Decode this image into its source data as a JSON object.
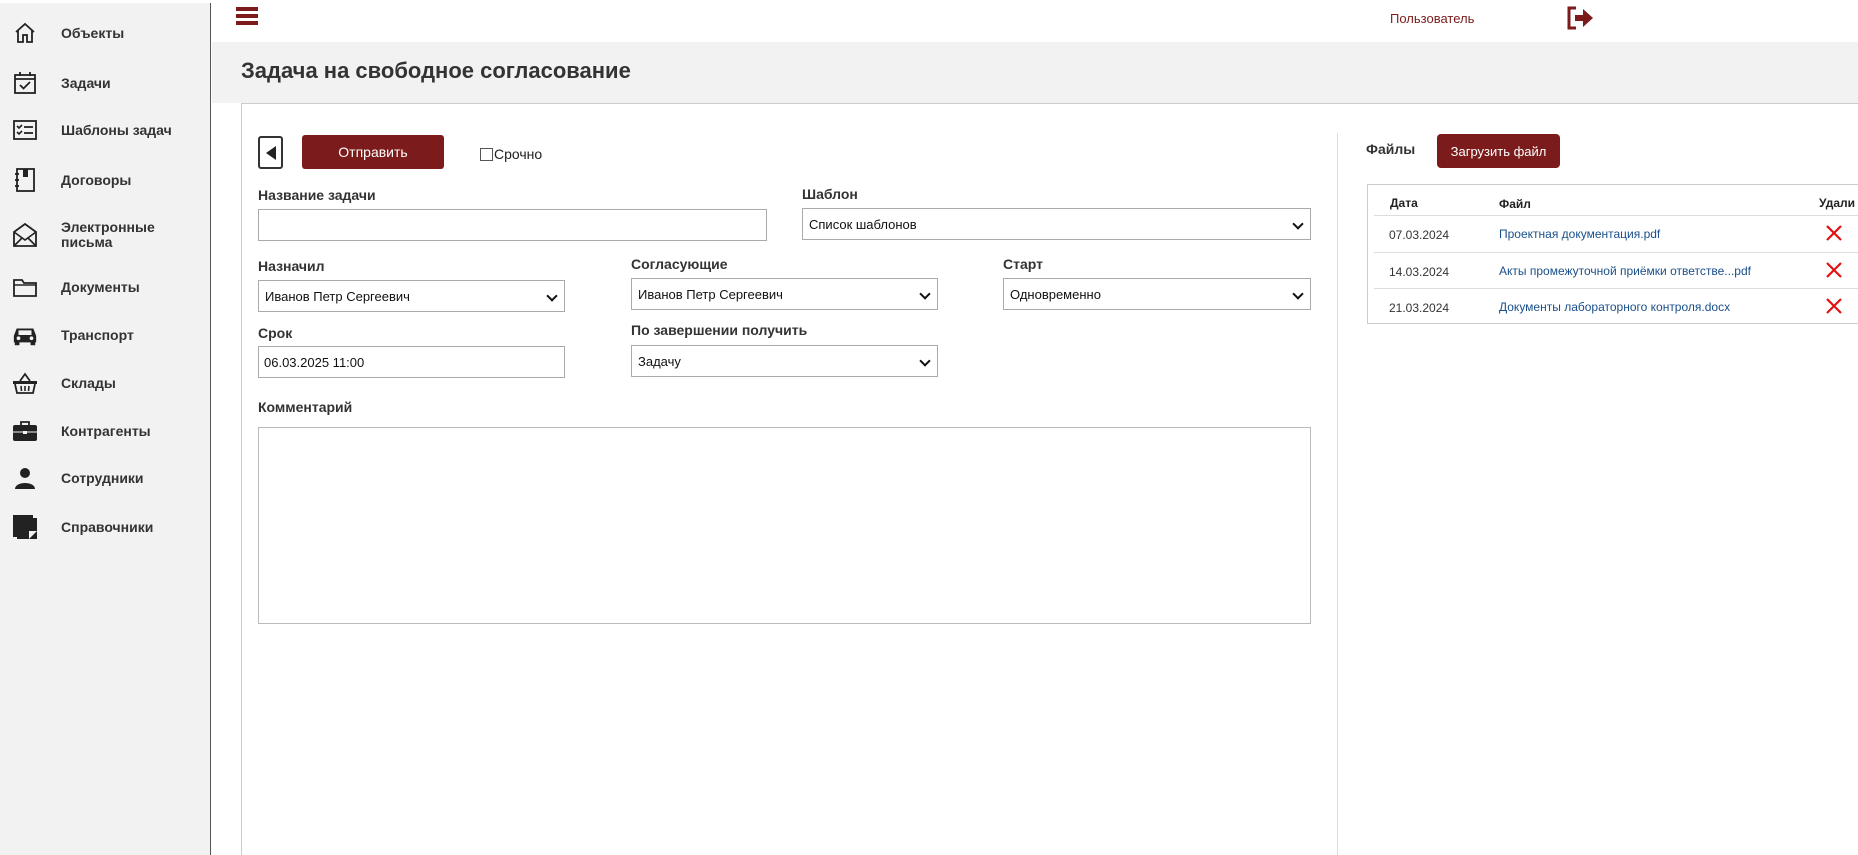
{
  "sidebar": {
    "items": [
      {
        "label": "Объекты",
        "icon": "home-icon"
      },
      {
        "label": "Задачи",
        "icon": "calendar-check-icon"
      },
      {
        "label": "Шаблоны задач",
        "icon": "checklist-icon"
      },
      {
        "label": "Договоры",
        "icon": "notebook-icon"
      },
      {
        "label": "Электронные письма",
        "icon": "envelope-icon"
      },
      {
        "label": "Документы",
        "icon": "folder-icon"
      },
      {
        "label": "Транспорт",
        "icon": "car-icon"
      },
      {
        "label": "Склады",
        "icon": "basket-icon"
      },
      {
        "label": "Контрагенты",
        "icon": "briefcase-icon"
      },
      {
        "label": "Сотрудники",
        "icon": "person-icon"
      },
      {
        "label": "Справочники",
        "icon": "sticky-note-icon"
      }
    ]
  },
  "topbar": {
    "user_label": "Пользователь",
    "menu_icon": "hamburger-icon",
    "logout_icon": "logout-icon"
  },
  "page": {
    "title": "Задача на свободное согласование"
  },
  "toolbar": {
    "send_label": "Отправить",
    "urgent_label": "Срочно",
    "urgent_checked": false
  },
  "form": {
    "task_name_label": "Название задачи",
    "task_name_value": "",
    "template_label": "Шаблон",
    "template_value": "Список шаблонов",
    "assigned_label": "Назначил",
    "assigned_value": "Иванов Петр Сергеевич",
    "approvers_label": "Согласующие",
    "approvers_value": "Иванов Петр Сергеевич",
    "start_label": "Старт",
    "start_value": "Одновременно",
    "deadline_label": "Срок",
    "deadline_value": "06.03.2025 11:00",
    "on_complete_label": "По завершении получить",
    "on_complete_value": "Задачу",
    "comment_label": "Комментарий",
    "comment_value": ""
  },
  "files": {
    "label": "Файлы",
    "upload_label": "Загрузить файл",
    "columns": {
      "date": "Дата",
      "file": "Файл",
      "delete": "Удали"
    },
    "rows": [
      {
        "date": "07.03.2024",
        "name": "Проектная документация.pdf"
      },
      {
        "date": "14.03.2024",
        "name": "Акты промежуточной приёмки ответстве...pdf"
      },
      {
        "date": "21.03.2024",
        "name": "Документы лабораторного контроля.docx"
      }
    ]
  },
  "colors": {
    "accent": "#7b1b1b",
    "link": "#1a4f8a",
    "delete": "#e01010",
    "sidebar_bg": "#f2f2f2"
  }
}
